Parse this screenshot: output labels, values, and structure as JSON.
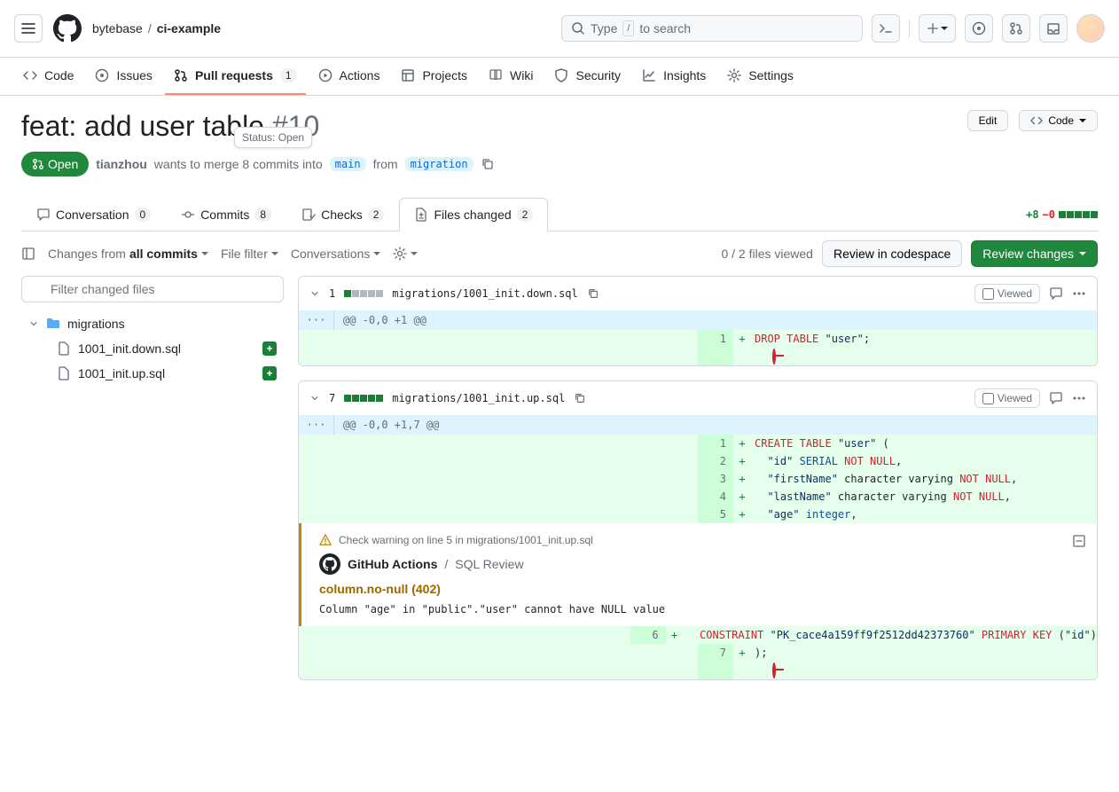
{
  "breadcrumb": {
    "owner": "bytebase",
    "repo": "ci-example"
  },
  "search": {
    "prefix": "Type",
    "key": "/",
    "suffix": "to search"
  },
  "repoNav": {
    "code": "Code",
    "issues": "Issues",
    "pulls": "Pull requests",
    "pullsCount": "1",
    "actions": "Actions",
    "projects": "Projects",
    "wiki": "Wiki",
    "security": "Security",
    "insights": "Insights",
    "settings": "Settings"
  },
  "pr": {
    "title": "feat: add user table",
    "number": "#10",
    "edit": "Edit",
    "codeBtn": "Code",
    "state": "Open",
    "tooltip": "Status: Open",
    "author": "tianzhou",
    "mergeText1": "wants to merge 8 commits into",
    "base": "main",
    "fromText": "from",
    "head": "migration"
  },
  "prTabs": {
    "conversation": "Conversation",
    "conversationCount": "0",
    "commits": "Commits",
    "commitsCount": "8",
    "checks": "Checks",
    "checksCount": "2",
    "files": "Files changed",
    "filesCount": "2",
    "additions": "+8",
    "deletions": "−0"
  },
  "toolbar": {
    "changesFrom": "Changes from",
    "allCommits": "all commits",
    "fileFilter": "File filter",
    "conversations": "Conversations",
    "viewed": "0 / 2 files viewed",
    "reviewCodespace": "Review in codespace",
    "reviewChanges": "Review changes"
  },
  "sidebar": {
    "filterPlaceholder": "Filter changed files",
    "folder": "migrations",
    "file1": "1001_init.down.sql",
    "file2": "1001_init.up.sql"
  },
  "file1": {
    "changes": "1",
    "path": "migrations/1001_init.down.sql",
    "viewed": "Viewed",
    "hunk": "@@ -0,0 +1 @@",
    "line1": {
      "num": "1",
      "code_kw1": "DROP",
      "code_kw2": "TABLE",
      "code_str": "\"user\"",
      "code_end": ";"
    }
  },
  "file2": {
    "changes": "7",
    "path": "migrations/1001_init.up.sql",
    "viewed": "Viewed",
    "hunk": "@@ -0,0 +1,7 @@",
    "lines": {
      "l1": {
        "num": "1",
        "kw1": "CREATE",
        "kw2": "TABLE",
        "str": "\"user\"",
        "end": " ("
      },
      "l2": {
        "num": "2",
        "pre": "  ",
        "str": "\"id\"",
        "type": " SERIAL",
        "nn": " NOT NULL",
        "end": ","
      },
      "l3": {
        "num": "3",
        "pre": "  ",
        "str": "\"firstName\"",
        "type": " character varying",
        "nn": " NOT NULL",
        "end": ","
      },
      "l4": {
        "num": "4",
        "pre": "  ",
        "str": "\"lastName\"",
        "type": " character varying",
        "nn": " NOT NULL",
        "end": ","
      },
      "l5": {
        "num": "5",
        "pre": "  ",
        "str": "\"age\"",
        "type": " integer",
        "end": ","
      },
      "l6": {
        "num": "6",
        "pre": "  ",
        "kw": "CONSTRAINT",
        "str1": " \"PK_cace4a159ff9f2512dd42373760\"",
        "kw2": " PRIMARY KEY",
        "paren": " (",
        "str2": "\"id\"",
        "end": ")"
      },
      "l7": {
        "num": "7",
        "code": ");"
      }
    }
  },
  "annotation": {
    "warnText": "Check warning on line 5 in migrations/1001_init.up.sql",
    "source": "GitHub Actions",
    "sep": "/",
    "check": "SQL Review",
    "rule": "column.no-null (402)",
    "message": "Column \"age\" in \"public\".\"user\" cannot have NULL value"
  }
}
